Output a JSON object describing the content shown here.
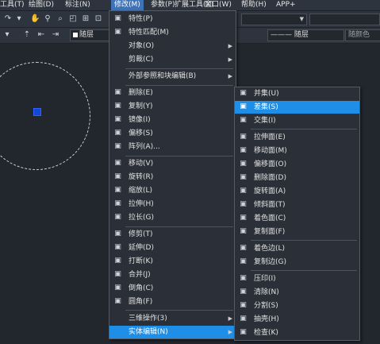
{
  "menubar": [
    "工具(T)",
    "绘图(D)",
    "标注(N)",
    "修改(M)",
    "参数(P)",
    "扩展工具(X)",
    "窗口(W)",
    "帮助(H)",
    "APP+"
  ],
  "toolbar": {
    "layer_name": "随层",
    "linetype": "——— 随层",
    "color": "随颜色"
  },
  "modify_menu": {
    "items": [
      {
        "icon": "properties-icon",
        "label": "特性(P)"
      },
      {
        "icon": "match-properties-icon",
        "label": "特性匹配(M)"
      },
      {
        "icon": "",
        "label": "对象(O)",
        "submenu": true
      },
      {
        "icon": "",
        "label": "剪裁(C)",
        "submenu": true
      },
      {
        "icon": "",
        "label": "外部参照和块编辑(B)",
        "submenu": true
      },
      {
        "icon": "erase-icon",
        "label": "删除(E)"
      },
      {
        "icon": "copy-icon",
        "label": "复制(Y)"
      },
      {
        "icon": "mirror-icon",
        "label": "镜像(I)"
      },
      {
        "icon": "offset-icon",
        "label": "偏移(S)"
      },
      {
        "icon": "array-icon",
        "label": "阵列(A)..."
      },
      {
        "icon": "move-icon",
        "label": "移动(V)"
      },
      {
        "icon": "rotate-icon",
        "label": "旋转(R)"
      },
      {
        "icon": "scale-icon",
        "label": "缩放(L)"
      },
      {
        "icon": "stretch-icon",
        "label": "拉伸(H)"
      },
      {
        "icon": "lengthen-icon",
        "label": "拉长(G)"
      },
      {
        "icon": "trim-icon",
        "label": "修剪(T)"
      },
      {
        "icon": "extend-icon",
        "label": "延伸(D)"
      },
      {
        "icon": "break-icon",
        "label": "打断(K)"
      },
      {
        "icon": "join-icon",
        "label": "合并(J)"
      },
      {
        "icon": "chamfer-icon",
        "label": "倒角(C)"
      },
      {
        "icon": "fillet-icon",
        "label": "圆角(F)"
      },
      {
        "icon": "",
        "label": "三维操作(3)",
        "submenu": true
      },
      {
        "icon": "",
        "label": "实体编辑(N)",
        "submenu": true,
        "highlighted": true
      }
    ]
  },
  "solid_edit_menu": {
    "items": [
      {
        "icon": "union-icon",
        "label": "并集(U)"
      },
      {
        "icon": "subtract-icon",
        "label": "差集(S)",
        "highlighted": true
      },
      {
        "icon": "intersect-icon",
        "label": "交集(I)"
      },
      {
        "icon": "extrude-faces-icon",
        "label": "拉伸面(E)"
      },
      {
        "icon": "move-faces-icon",
        "label": "移动面(M)"
      },
      {
        "icon": "offset-faces-icon",
        "label": "偏移面(O)"
      },
      {
        "icon": "delete-faces-icon",
        "label": "删除面(D)"
      },
      {
        "icon": "rotate-faces-icon",
        "label": "旋转面(A)"
      },
      {
        "icon": "taper-faces-icon",
        "label": "倾斜面(T)"
      },
      {
        "icon": "color-faces-icon",
        "label": "着色面(C)"
      },
      {
        "icon": "copy-faces-icon",
        "label": "复制面(F)"
      },
      {
        "icon": "color-edges-icon",
        "label": "着色边(L)"
      },
      {
        "icon": "copy-edges-icon",
        "label": "复制边(G)"
      },
      {
        "icon": "imprint-icon",
        "label": "压印(I)"
      },
      {
        "icon": "clean-icon",
        "label": "清除(N)"
      },
      {
        "icon": "separate-icon",
        "label": "分割(S)"
      },
      {
        "icon": "shell-icon",
        "label": "抽壳(H)"
      },
      {
        "icon": "check-icon",
        "label": "检查(K)"
      }
    ]
  },
  "colors": {
    "highlight": "#1e8ee6",
    "menu_bg": "#2b3038",
    "canvas": "#22262d",
    "grip": "#1446d8"
  }
}
